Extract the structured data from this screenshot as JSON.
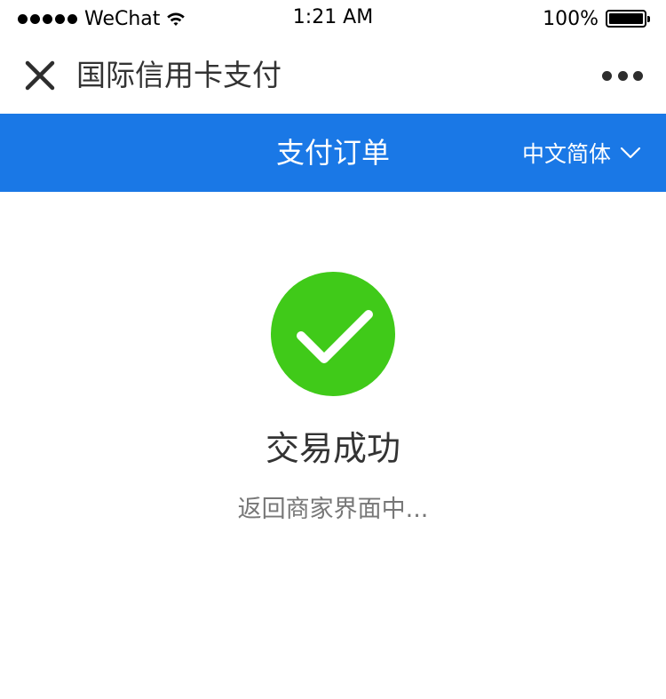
{
  "status_bar": {
    "carrier": "WeChat",
    "time": "1:21 AM",
    "battery": "100%",
    "battery_level": 1.0
  },
  "nav": {
    "title": "国际信用卡支付",
    "close_icon": "close-icon",
    "more_icon": "more-icon"
  },
  "header": {
    "title": "支付订单",
    "language": "中文简体",
    "background": "#1a78e6"
  },
  "result": {
    "icon": "check-icon",
    "color": "#40ca19",
    "title": "交易成功",
    "message": "返回商家界面中..."
  }
}
